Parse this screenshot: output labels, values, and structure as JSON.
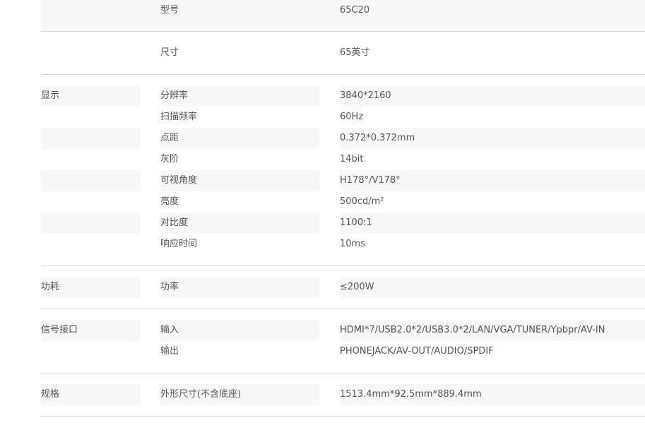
{
  "spec_table": {
    "sections": [
      {
        "group": "",
        "rows": [
          {
            "name": "型号",
            "value": "65C20"
          }
        ]
      },
      {
        "group": "",
        "rows": [
          {
            "name": "尺寸",
            "value": "65英寸"
          }
        ]
      },
      {
        "group": "显示",
        "rows": [
          {
            "name": "分辨率",
            "value": "3840*2160"
          },
          {
            "name": "扫描频率",
            "value": "60Hz"
          },
          {
            "name": "点距",
            "value": "0.372*0.372mm"
          },
          {
            "name": "灰阶",
            "value": "14bit"
          },
          {
            "name": "可视角度",
            "value": "H178°/V178°"
          },
          {
            "name": "亮度",
            "value": "500cd/m²"
          },
          {
            "name": "对比度",
            "value": "1100:1"
          },
          {
            "name": "响应时间",
            "value": "10ms"
          }
        ]
      },
      {
        "group": "功耗",
        "rows": [
          {
            "name": "功率",
            "value": "≤200W"
          }
        ]
      },
      {
        "group": "信号接口",
        "rows": [
          {
            "name": "输入",
            "value": "HDMI*7/USB2.0*2/USB3.0*2/LAN/VGA/TUNER/Ypbpr/AV-IN"
          },
          {
            "name": "输出",
            "value": "PHONEJACK/AV-OUT/AUDIO/SPDIF"
          }
        ]
      },
      {
        "group": "规格",
        "rows": [
          {
            "name": "外形尺寸(不含底座)",
            "value": "1513.4mm*92.5mm*889.4mm"
          }
        ]
      }
    ]
  }
}
